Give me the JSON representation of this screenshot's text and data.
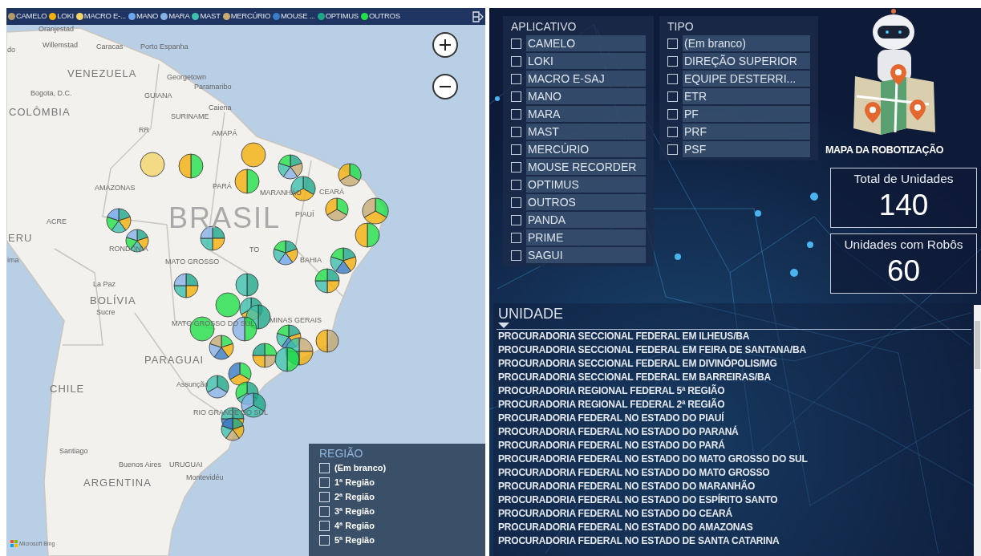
{
  "map": {
    "legend": [
      {
        "label": "CAMELO",
        "color": "#b39a6b"
      },
      {
        "label": "LOKI",
        "color": "#f2b00c"
      },
      {
        "label": "MACRO E-...",
        "color": "#f3d46a"
      },
      {
        "label": "MANO",
        "color": "#6ea6ee"
      },
      {
        "label": "MARA",
        "color": "#86b1e6"
      },
      {
        "label": "MAST",
        "color": "#3cc0ae"
      },
      {
        "label": "MERCÚRIO",
        "color": "#c6aa72"
      },
      {
        "label": "MOUSE ...",
        "color": "#3a7cc6"
      },
      {
        "label": "OPTIMUS",
        "color": "#1ea889"
      },
      {
        "label": "OUTROS",
        "color": "#22e04a"
      }
    ],
    "labels": [
      "Oranjestad",
      "do",
      "Willemstad",
      "Caracas",
      "Porto Espanha",
      "VENEZUELA",
      "Georgetown",
      "Paramaribo",
      "GUIANA",
      "Caiena",
      "Bogota, D.C.",
      "COLÔMBIA",
      "SURINAME",
      "RR",
      "AMAPÁ",
      "AMAZONAS",
      "PARÁ",
      "MARANHÃO",
      "CEARÁ",
      "BRASIL",
      "PIAUÍ",
      "ACRE",
      "ERU",
      "RONDÔNIA",
      "ima",
      "MATO GROSSO",
      "TO",
      "BAHIA",
      "La Paz",
      "BOLÍVIA",
      "Sucre",
      "MINAS GERAIS",
      "MATO GROSSO DO SUL",
      "PARAGUAI",
      "Assunção",
      "CHILE",
      "RIO GRANDE DO SUL",
      "Santiago",
      "Buenos Aires",
      "URUGUAI",
      "Montevidéu",
      "ARGENTINA"
    ],
    "attribution": "Microsoft Bing",
    "region": {
      "title": "REGIÃO",
      "items": [
        {
          "label": "(Em branco)",
          "checked": false
        },
        {
          "label": "1ª Região",
          "checked": false
        },
        {
          "label": "2ª Região",
          "checked": false
        },
        {
          "label": "3ª Região",
          "checked": false
        },
        {
          "label": "4ª Região",
          "checked": false
        },
        {
          "label": "5ª Região",
          "checked": false
        }
      ]
    }
  },
  "aplicativo": {
    "title": "APLICATIVO",
    "items": [
      {
        "label": "CAMELO",
        "checked": false
      },
      {
        "label": "LOKI",
        "checked": false
      },
      {
        "label": "MACRO E-SAJ",
        "checked": false
      },
      {
        "label": "MANO",
        "checked": false
      },
      {
        "label": "MARA",
        "checked": false
      },
      {
        "label": "MAST",
        "checked": false
      },
      {
        "label": "MERCÚRIO",
        "checked": false
      },
      {
        "label": "MOUSE RECORDER",
        "checked": false
      },
      {
        "label": "OPTIMUS",
        "checked": false
      },
      {
        "label": "OUTROS",
        "checked": false
      },
      {
        "label": "PANDA",
        "checked": false
      },
      {
        "label": "PRIME",
        "checked": false
      },
      {
        "label": "SAGUI",
        "checked": false
      }
    ]
  },
  "tipo": {
    "title": "TIPO",
    "items": [
      {
        "label": "(Em branco)",
        "checked": false
      },
      {
        "label": "DIREÇÃO SUPERIOR",
        "checked": false
      },
      {
        "label": "EQUIPE DESTERRI...",
        "checked": false
      },
      {
        "label": "ETR",
        "checked": false
      },
      {
        "label": "PF",
        "checked": false
      },
      {
        "label": "PRF",
        "checked": false
      },
      {
        "label": "PSF",
        "checked": false
      }
    ]
  },
  "title": "MAPA DA ROBOTIZAÇÃO",
  "cards": [
    {
      "label": "Total de Unidades",
      "value": "140"
    },
    {
      "label": "Unidades com Robôs",
      "value": "60"
    }
  ],
  "unidade": {
    "title": "UNIDADE",
    "rows": [
      "PROCURADORIA SECCIONAL FEDERAL EM ILHEUS/BA",
      "PROCURADORIA SECCIONAL FEDERAL EM FEIRA DE SANTANA/BA",
      "PROCURADORIA SECCIONAL FEDERAL EM DIVINÓPOLIS/MG",
      "PROCURADORIA SECCIONAL FEDERAL EM BARREIRAS/BA",
      "PROCURADORIA REGIONAL FEDERAL 5ª REGIÃO",
      "PROCURADORIA REGIONAL FEDERAL 2ª REGIÃO",
      "PROCURADORIA FEDERAL NO ESTADO DO PIAUÍ",
      "PROCURADORIA FEDERAL NO ESTADO DO PARANÁ",
      "PROCURADORIA FEDERAL NO ESTADO DO PARÁ",
      "PROCURADORIA FEDERAL NO ESTADO DO MATO GROSSO DO SUL",
      "PROCURADORIA FEDERAL NO ESTADO DO MATO GROSSO",
      "PROCURADORIA FEDERAL NO ESTADO DO MARANHÃO",
      "PROCURADORIA FEDERAL NO ESTADO DO ESPÍRITO SANTO",
      "PROCURADORIA FEDERAL NO ESTADO DO CEARÁ",
      "PROCURADORIA FEDERAL NO ESTADO DO AMAZONAS",
      "PROCURADORIA FEDERAL NO ESTADO DE SANTA CATARINA"
    ]
  }
}
